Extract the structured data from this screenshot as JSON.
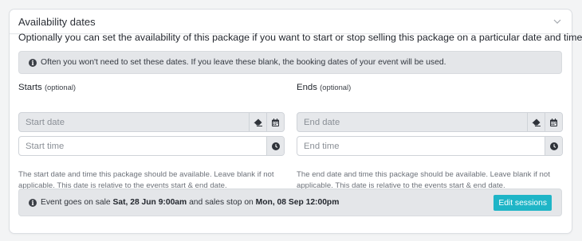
{
  "panel": {
    "title": "Availability dates",
    "intro": "Optionally you can set the availability of this package if you want to start or stop selling this package on a particular date and time.",
    "info_note": "Often you won't need to set these dates. If you leave these blank, the booking dates of your event will be used."
  },
  "starts": {
    "label": "Starts",
    "optional": "(optional)",
    "date_placeholder": "Start date",
    "time_placeholder": "Start time",
    "help": "The start date and time this package should be available. Leave blank if not applicable. This date is relative to the events start & end date."
  },
  "ends": {
    "label": "Ends",
    "optional": "(optional)",
    "date_placeholder": "End date",
    "time_placeholder": "End time",
    "help": "The end date and time this package should be available. Leave blank if not applicable. This date is relative to the events start & end date."
  },
  "sale": {
    "prefix": "Event goes on sale",
    "start": "Sat, 28 Jun 9:00am",
    "middle": "and sales stop on",
    "end": "Mon, 08 Sep 12:00pm",
    "button": "Edit sessions"
  },
  "icons": {
    "collapse": "chevron-down-icon",
    "info": "info-circle-icon",
    "clear": "eraser-icon",
    "calendar": "calendar-icon",
    "clock": "clock-icon"
  },
  "colors": {
    "accent": "#1fb5c7",
    "info_bg": "#e4e6e9"
  }
}
